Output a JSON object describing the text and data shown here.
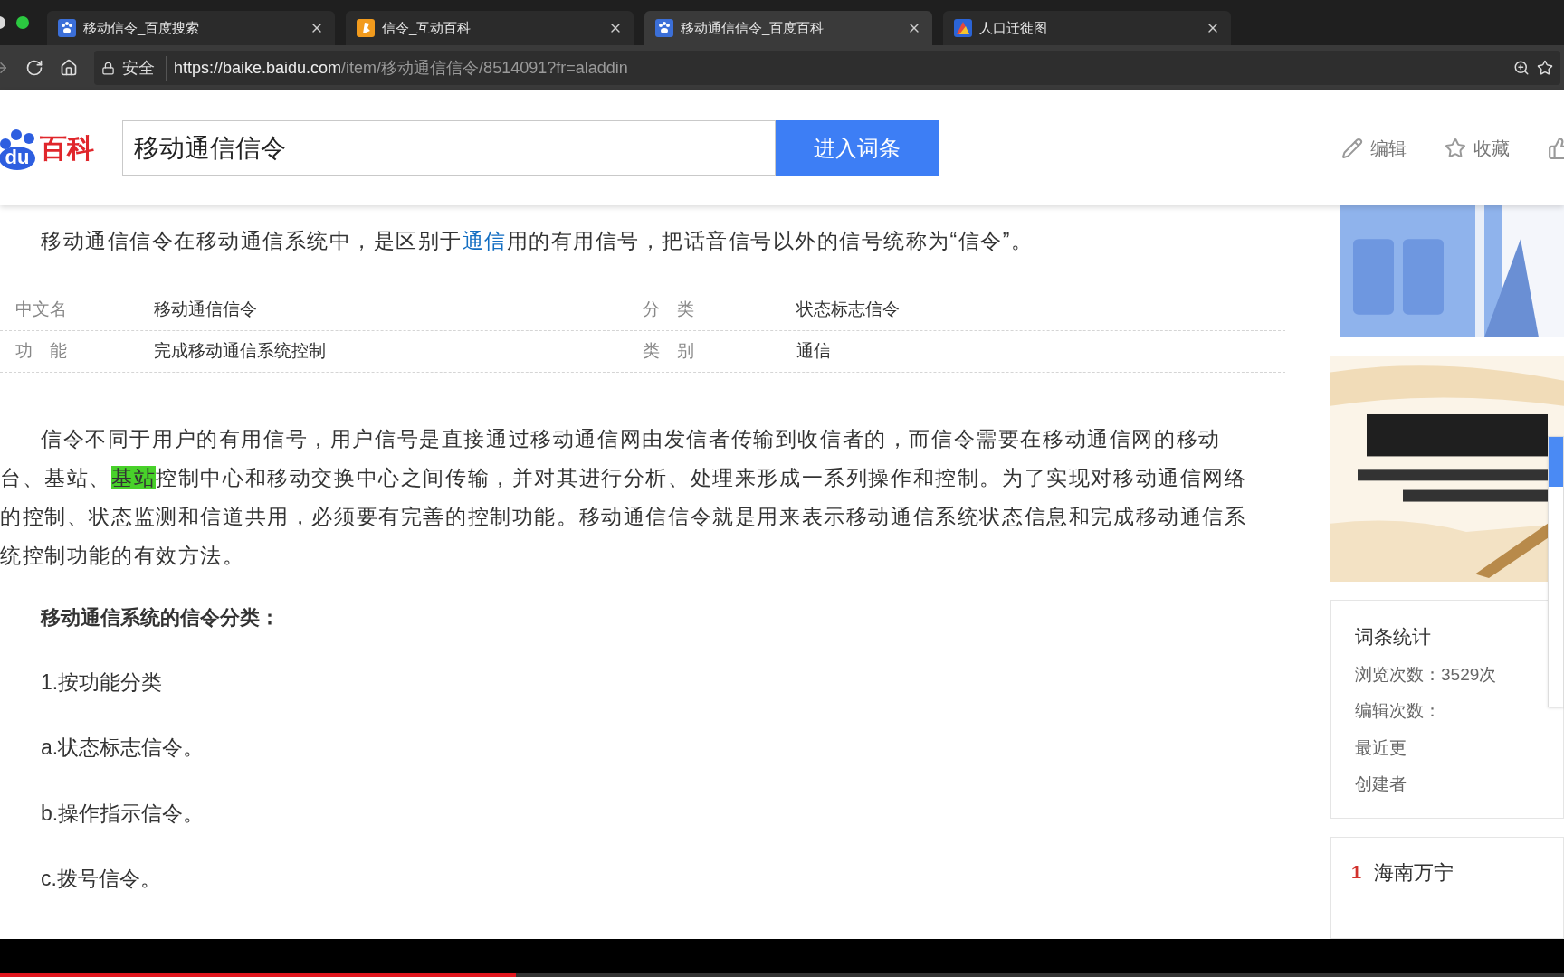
{
  "browser": {
    "tabs": [
      {
        "title": "移动信令_百度搜索",
        "selected": false
      },
      {
        "title": "信令_互动百科",
        "selected": false
      },
      {
        "title": "移动通信信令_百度百科",
        "selected": true
      },
      {
        "title": "人口迁徙图",
        "selected": false
      }
    ],
    "security": "安全",
    "url_host": "https://baike.baidu.com",
    "url_path": "/item/移动通信信令/8514091?fr=aladdin"
  },
  "header": {
    "logo_badge": "du",
    "logo_text": "百科",
    "search_value": "移动通信信令",
    "search_button": "进入词条",
    "actions": [
      {
        "label": "编辑"
      },
      {
        "label": "收藏"
      }
    ]
  },
  "intro": [
    {
      "text": "移动通信信令在移动通信系统中，是区别于"
    },
    {
      "text": "通信",
      "kind": "link"
    },
    {
      "text": "用的有用信号，把话音信号以外的信号统称为“信令”。"
    }
  ],
  "basic_info": [
    {
      "name1": "中文名",
      "value1": "移动通信信令",
      "name2": "分　类",
      "value2": "状态标志信令"
    },
    {
      "name1": "功　能",
      "value1": "完成移动通信系统控制",
      "name2": "类　别",
      "value2": "通信"
    }
  ],
  "paragraph": [
    [
      {
        "text": "信令不同于用户的有用信号，用户信号是直接通过移动通信网由发信者传输到收信者的，而信令需要在移动通信网的移动"
      }
    ],
    [
      {
        "text": "台、基站、"
      },
      {
        "text": "基站",
        "highlighted": true
      },
      {
        "text": "控制中心和移动交换中心之间传输，并对其进行分析、处理来形成一系列操作和控制。为了实现对移动通信网络"
      }
    ],
    [
      {
        "text": "的控制、状态监测和信道共用，必须要有完善的控制功能。移动通信信令就是用来表示移动通信系统状态信息和完成移动通信系"
      }
    ],
    [
      {
        "text": "统控制功能的有效方法。"
      }
    ]
  ],
  "section_heading": "移动通信系统的信令分类：",
  "list": [
    "1.按功能分类",
    "a.状态标志信令。",
    "b.操作指示信令。",
    "c.拨号信令。"
  ],
  "sidebar": {
    "stats_title": "词条统计",
    "stats": [
      "浏览次数：3529次",
      "编辑次数：",
      "最近更",
      "创建者"
    ],
    "hot": [
      {
        "rank": "1",
        "title": "海南万宁"
      }
    ]
  },
  "video_progress": {
    "level": 0.33
  }
}
